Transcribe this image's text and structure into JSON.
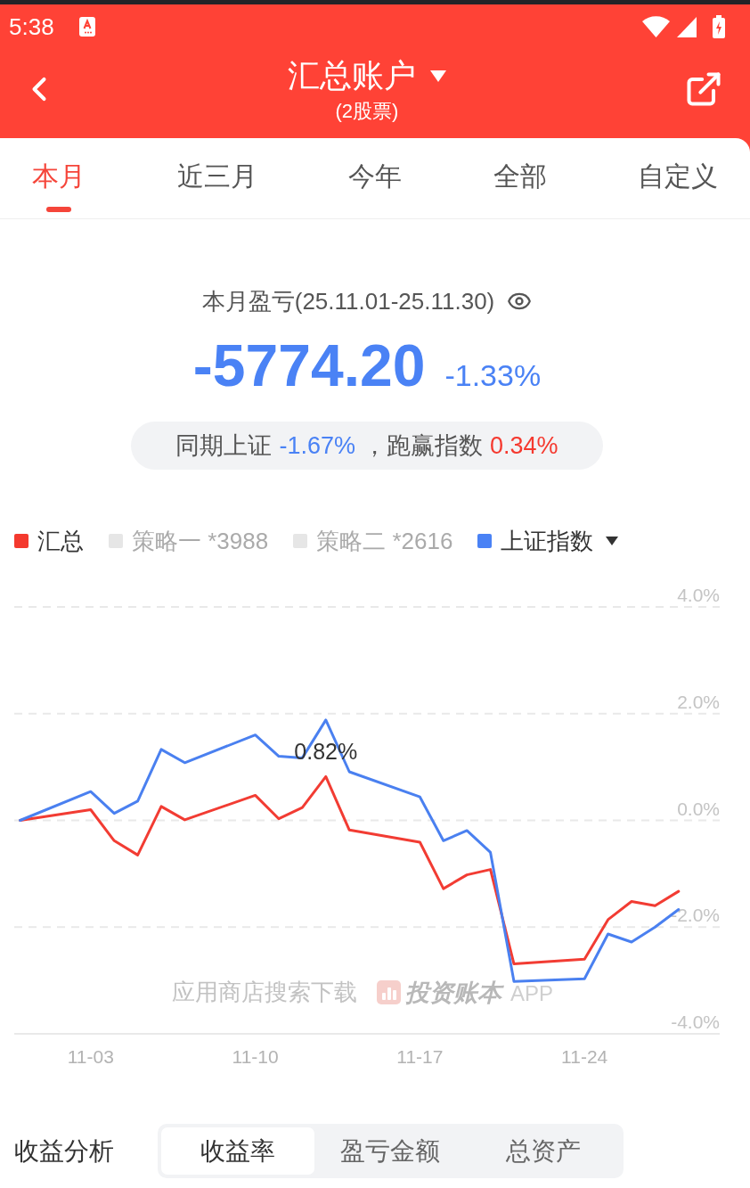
{
  "status_bar": {
    "time": "5:38"
  },
  "header": {
    "title": "汇总账户",
    "subtitle": "(2股票)"
  },
  "tabs": [
    {
      "label": "本月",
      "selected": true
    },
    {
      "label": "近三月",
      "selected": false
    },
    {
      "label": "今年",
      "selected": false
    },
    {
      "label": "全部",
      "selected": false
    },
    {
      "label": "自定义",
      "selected": false
    }
  ],
  "summary": {
    "title": "本月盈亏(25.11.01-25.11.30)",
    "amount": "-5774.20",
    "percent": "-1.33%",
    "comparison": [
      {
        "text": "同期上证",
        "kind": "label"
      },
      {
        "text": "-1.67%",
        "kind": "loss"
      },
      {
        "text": "，跑赢指数",
        "kind": "label"
      },
      {
        "text": "0.34%",
        "kind": "gain"
      }
    ]
  },
  "legend": [
    {
      "label": "汇总",
      "color": "#f4392e",
      "active": true,
      "dropdown": false
    },
    {
      "label": "策略一 *3988",
      "active": false,
      "dropdown": false
    },
    {
      "label": "策略二 *2616",
      "active": false,
      "dropdown": false
    },
    {
      "label": "上证指数",
      "color": "#4a82f5",
      "active": true,
      "dropdown": true
    }
  ],
  "chart": {
    "watermark": {
      "hint": "应用商店搜索下载",
      "brand": "投资账本",
      "suffix": "APP"
    },
    "chart_data": {
      "type": "line",
      "grid": true,
      "categories": [
        null,
        null,
        null,
        "11-03",
        null,
        null,
        null,
        null,
        null,
        null,
        "11-10",
        null,
        null,
        null,
        null,
        null,
        null,
        "11-17",
        null,
        null,
        null,
        null,
        null,
        null,
        "11-24",
        null,
        null,
        null,
        null,
        null
      ],
      "ylim": [
        -4,
        4
      ],
      "yticks": [
        {
          "value": 4,
          "label": "4.0%"
        },
        {
          "value": 2,
          "label": "2.0%"
        },
        {
          "value": 0,
          "label": "0.0%"
        },
        {
          "value": -2,
          "label": "-2.0%"
        },
        {
          "value": -4,
          "label": "-4.0%"
        }
      ],
      "series": [
        {
          "color": "#f23c33",
          "values": [
            0,
            null,
            null,
            0.2,
            -0.38,
            -0.65,
            0.26,
            0.01,
            null,
            null,
            0.47,
            0.03,
            0.24,
            0.82,
            -0.18,
            null,
            null,
            -0.41,
            -1.28,
            -1.02,
            -0.92,
            -2.69,
            null,
            null,
            -2.6,
            -1.86,
            -1.52,
            -1.6,
            -1.33,
            null
          ]
        },
        {
          "color": "#4a80f0",
          "values": [
            0,
            null,
            null,
            0.54,
            0.13,
            0.36,
            1.33,
            1.08,
            null,
            null,
            1.6,
            1.2,
            1.17,
            1.88,
            0.91,
            null,
            null,
            0.44,
            -0.38,
            -0.19,
            -0.6,
            -3.02,
            null,
            null,
            -2.97,
            -2.13,
            -2.28,
            -2,
            -1.67,
            null
          ]
        }
      ],
      "annotations": [
        "0.82%"
      ]
    }
  },
  "analysis": {
    "title": "收益分析",
    "segments": [
      {
        "label": "收益率",
        "selected": true
      },
      {
        "label": "盈亏金额",
        "selected": false
      },
      {
        "label": "总资产",
        "selected": false
      }
    ]
  }
}
